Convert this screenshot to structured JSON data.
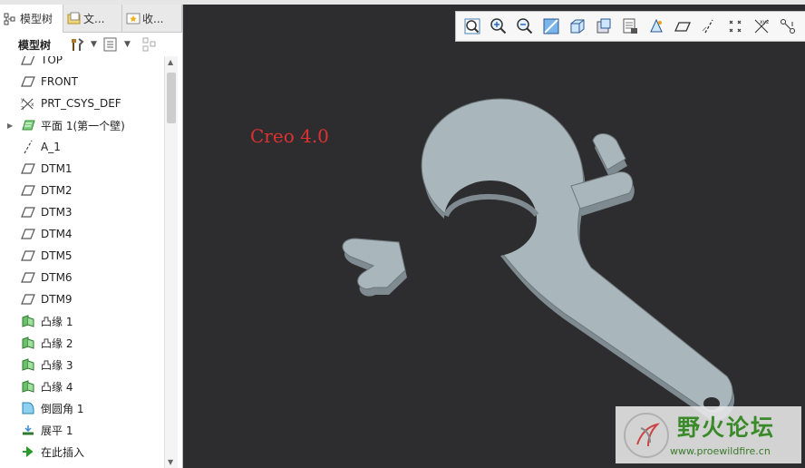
{
  "tabs": [
    {
      "label": "模型树",
      "icon": "model-tree-icon"
    },
    {
      "label": "文...",
      "icon": "folder-icon"
    },
    {
      "label": "收...",
      "icon": "favorites-icon"
    }
  ],
  "toolbar": {
    "label": "模型树",
    "settings_icon": "tools-icon",
    "show_icon": "list-icon",
    "filter_icon": "filter-icon"
  },
  "tree": [
    {
      "label": "TOP",
      "icon": "datum-plane-icon",
      "expander": ""
    },
    {
      "label": "FRONT",
      "icon": "datum-plane-icon",
      "expander": ""
    },
    {
      "label": "PRT_CSYS_DEF",
      "icon": "csys-icon",
      "expander": ""
    },
    {
      "label": "平面 1(第一个壁)",
      "icon": "sheetmetal-wall-icon",
      "expander": "▶"
    },
    {
      "label": "A_1",
      "icon": "datum-axis-icon",
      "expander": ""
    },
    {
      "label": "DTM1",
      "icon": "datum-plane-icon",
      "expander": ""
    },
    {
      "label": "DTM2",
      "icon": "datum-plane-icon",
      "expander": ""
    },
    {
      "label": "DTM3",
      "icon": "datum-plane-icon",
      "expander": ""
    },
    {
      "label": "DTM4",
      "icon": "datum-plane-icon",
      "expander": ""
    },
    {
      "label": "DTM5",
      "icon": "datum-plane-icon",
      "expander": ""
    },
    {
      "label": "DTM6",
      "icon": "datum-plane-icon",
      "expander": ""
    },
    {
      "label": "DTM9",
      "icon": "datum-plane-icon",
      "expander": ""
    },
    {
      "label": "凸缘 1",
      "icon": "flange-icon",
      "expander": ""
    },
    {
      "label": "凸缘 2",
      "icon": "flange-icon",
      "expander": ""
    },
    {
      "label": "凸缘 3",
      "icon": "flange-icon",
      "expander": ""
    },
    {
      "label": "凸缘 4",
      "icon": "flange-icon",
      "expander": ""
    },
    {
      "label": "倒圆角 1",
      "icon": "round-icon",
      "expander": ""
    },
    {
      "label": "展平 1",
      "icon": "unbend-icon",
      "expander": ""
    },
    {
      "label": "在此插入",
      "icon": "insert-here-icon",
      "expander": ""
    }
  ],
  "graphics_toolbar": [
    "refit-icon",
    "zoom-in-icon",
    "zoom-out-icon",
    "repaint-icon",
    "display-style-icon",
    "saved-orientations-icon",
    "view-manager-icon",
    "perspective-icon",
    "plane-display-icon",
    "axis-display-icon",
    "point-display-icon",
    "csys-display-icon",
    "annotation-display-icon"
  ],
  "viewport": {
    "overlay_text": "Creo 4.0",
    "background": "#2d2d30",
    "part_color": "#a9b6bb"
  },
  "watermark": {
    "title": "野火论坛",
    "url": "www.proewildfire.cn"
  }
}
